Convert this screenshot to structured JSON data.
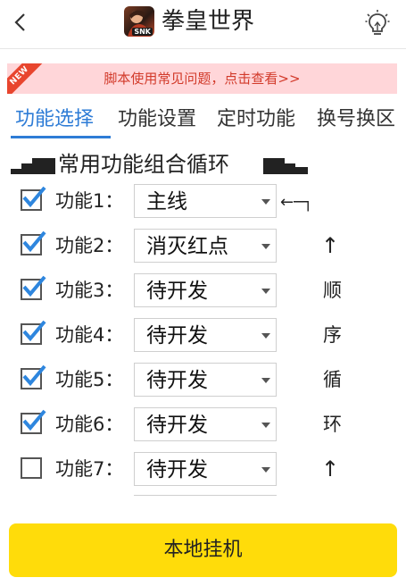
{
  "header": {
    "title": "拳皇世界",
    "logo_badge": "SNK",
    "back_icon": "chevron-left-icon",
    "tip_icon": "lightbulb-icon"
  },
  "notice": {
    "ribbon": "NEW",
    "text": "脚本使用常见问题，点击查看>>"
  },
  "tabs": [
    {
      "label": "功能选择",
      "active": true
    },
    {
      "label": "功能设置",
      "active": false
    },
    {
      "label": "定时功能",
      "active": false
    },
    {
      "label": "换号换区",
      "active": false
    }
  ],
  "section": {
    "title": "常用功能组合循环"
  },
  "rows": [
    {
      "label": "功能1：",
      "checked": true,
      "value": "主线",
      "side": "←─┐"
    },
    {
      "label": "功能2：",
      "checked": true,
      "value": "消灭红点",
      "side": "↑"
    },
    {
      "label": "功能3：",
      "checked": true,
      "value": "待开发",
      "side": "顺"
    },
    {
      "label": "功能4：",
      "checked": true,
      "value": "待开发",
      "side": "序"
    },
    {
      "label": "功能5：",
      "checked": true,
      "value": "待开发",
      "side": "循"
    },
    {
      "label": "功能6：",
      "checked": true,
      "value": "待开发",
      "side": "环"
    },
    {
      "label": "功能7：",
      "checked": false,
      "value": "待开发",
      "side": "↑"
    }
  ],
  "run_button": {
    "label": "本地挂机"
  },
  "colors": {
    "accent": "#2e7cd6",
    "notice_bg": "#ffd6d9",
    "notice_text": "#d23a2a",
    "run_button": "#ffdc0a",
    "check": "#2e86de"
  }
}
